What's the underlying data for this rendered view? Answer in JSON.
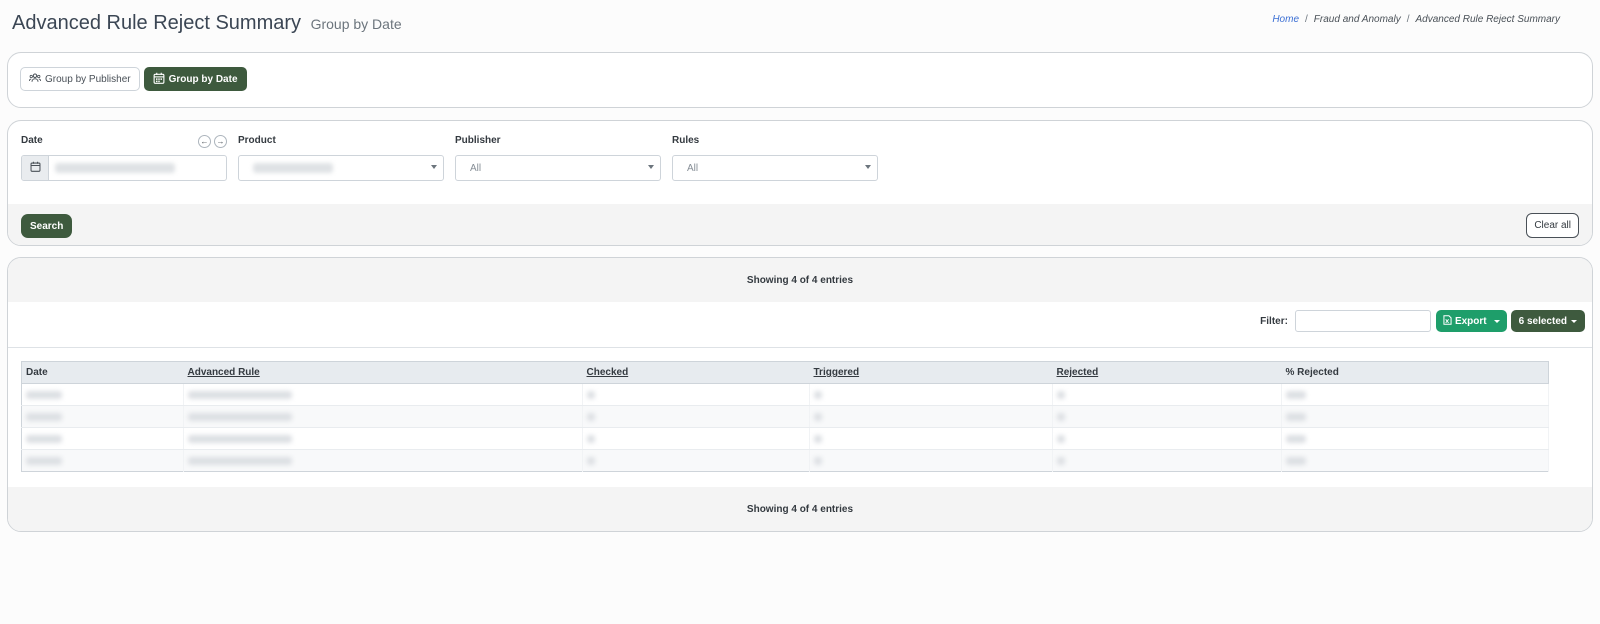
{
  "header": {
    "title": "Advanced Rule Reject Summary",
    "subtitle": "Group by Date",
    "breadcrumb": [
      {
        "label": "Home",
        "link": true
      },
      {
        "label": "Fraud and Anomaly",
        "link": false
      },
      {
        "label": "Advanced Rule Reject Summary",
        "link": false
      }
    ],
    "breadcrumb_separator": "/"
  },
  "view_toggle": {
    "by_publisher_label": "Group by Publisher",
    "by_date_label": "Group by Date",
    "active": "date"
  },
  "filters": {
    "date_label": "Date",
    "product_label": "Product",
    "publisher_label": "Publisher",
    "publisher_value": "All",
    "rules_label": "Rules",
    "rules_value": "All",
    "prev_icon": "arrow-left-icon",
    "next_icon": "arrow-right-icon",
    "search_label": "Search",
    "clear_label": "Clear all"
  },
  "table": {
    "showing_text": "Showing 4 of 4 entries",
    "filter_label": "Filter:",
    "export_label": "Export",
    "selected_label": "6 selected",
    "columns": [
      {
        "label": "Date",
        "sortable": false
      },
      {
        "label": "Advanced Rule",
        "sortable": true
      },
      {
        "label": "Checked",
        "sortable": true
      },
      {
        "label": "Triggered",
        "sortable": true
      },
      {
        "label": "Rejected",
        "sortable": true
      },
      {
        "label": "% Rejected",
        "sortable": false
      }
    ],
    "row_count": 4
  },
  "colors": {
    "primary_dark_green": "#3e5a3e",
    "export_green": "#1e9e6a",
    "link_blue": "#3b6fd4"
  }
}
